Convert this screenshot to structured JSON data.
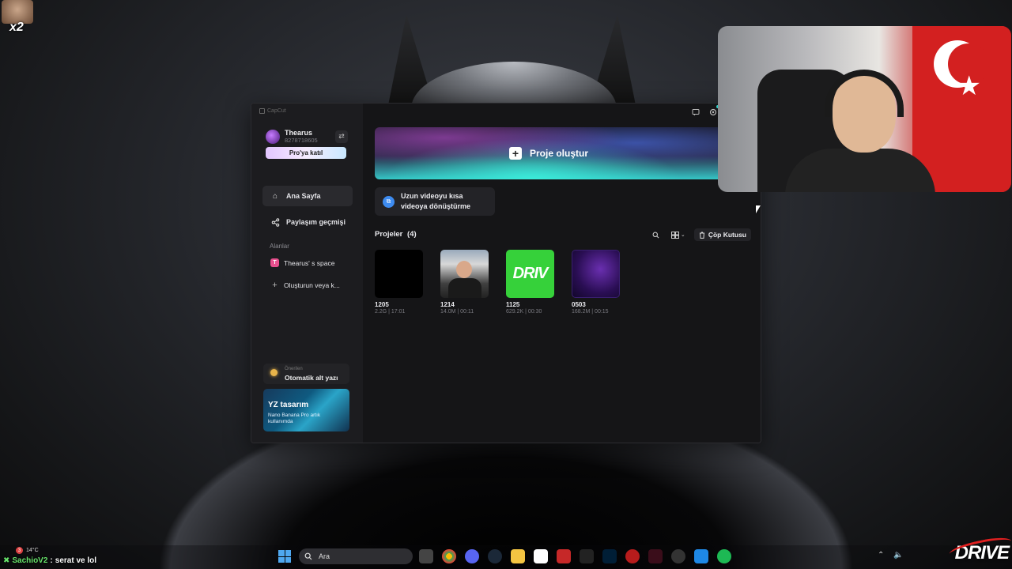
{
  "overlay": {
    "corner_multiplier": "x2",
    "chat": {
      "user": "SachioV2",
      "separator": ":",
      "message": "serat ve lol"
    },
    "weather": {
      "badge": "3",
      "temp": "14°C"
    },
    "brand": "DRIVE"
  },
  "app": {
    "title": "CapCut",
    "user": {
      "name": "Thearus",
      "id": "8278718605",
      "pro_label": "Pro'ya katıl"
    },
    "nav": {
      "home": "Ana Sayfa",
      "share_history": "Paylaşım geçmişi"
    },
    "spaces": {
      "label": "Alanlar",
      "items": [
        {
          "badge": "T",
          "label": "Thearus' s space"
        }
      ],
      "create_label": "Oluşturun veya k..."
    },
    "suggestion": {
      "small": "Önerilen",
      "title": "Otomatik alt yazı"
    },
    "promo": {
      "title": "YZ tasarım",
      "text": "Nano Banana Pro artık kullanımda"
    },
    "main": {
      "create_project": "Proje oluştur",
      "tool_card": "Uzun videoyu kısa videoya dönüştürme",
      "projects_label": "Projeler",
      "projects_count": "(4)",
      "trash_label": "Çöp Kutusu",
      "projects": [
        {
          "name": "1205",
          "meta": "2.2G | 17:01",
          "thumb": "black"
        },
        {
          "name": "1214",
          "meta": "14.0M | 00:11",
          "thumb": "person"
        },
        {
          "name": "1125",
          "meta": "629.2K | 00:30",
          "thumb": "green",
          "thumb_text": "DRIV"
        },
        {
          "name": "0503",
          "meta": "168.2M | 00:15",
          "thumb": "purple"
        }
      ]
    }
  },
  "taskbar": {
    "search_placeholder": "Ara"
  },
  "colors": {
    "accent_pink": "#e8508e",
    "accent_blue": "#3d8bf0",
    "brand_red": "#e02020"
  }
}
